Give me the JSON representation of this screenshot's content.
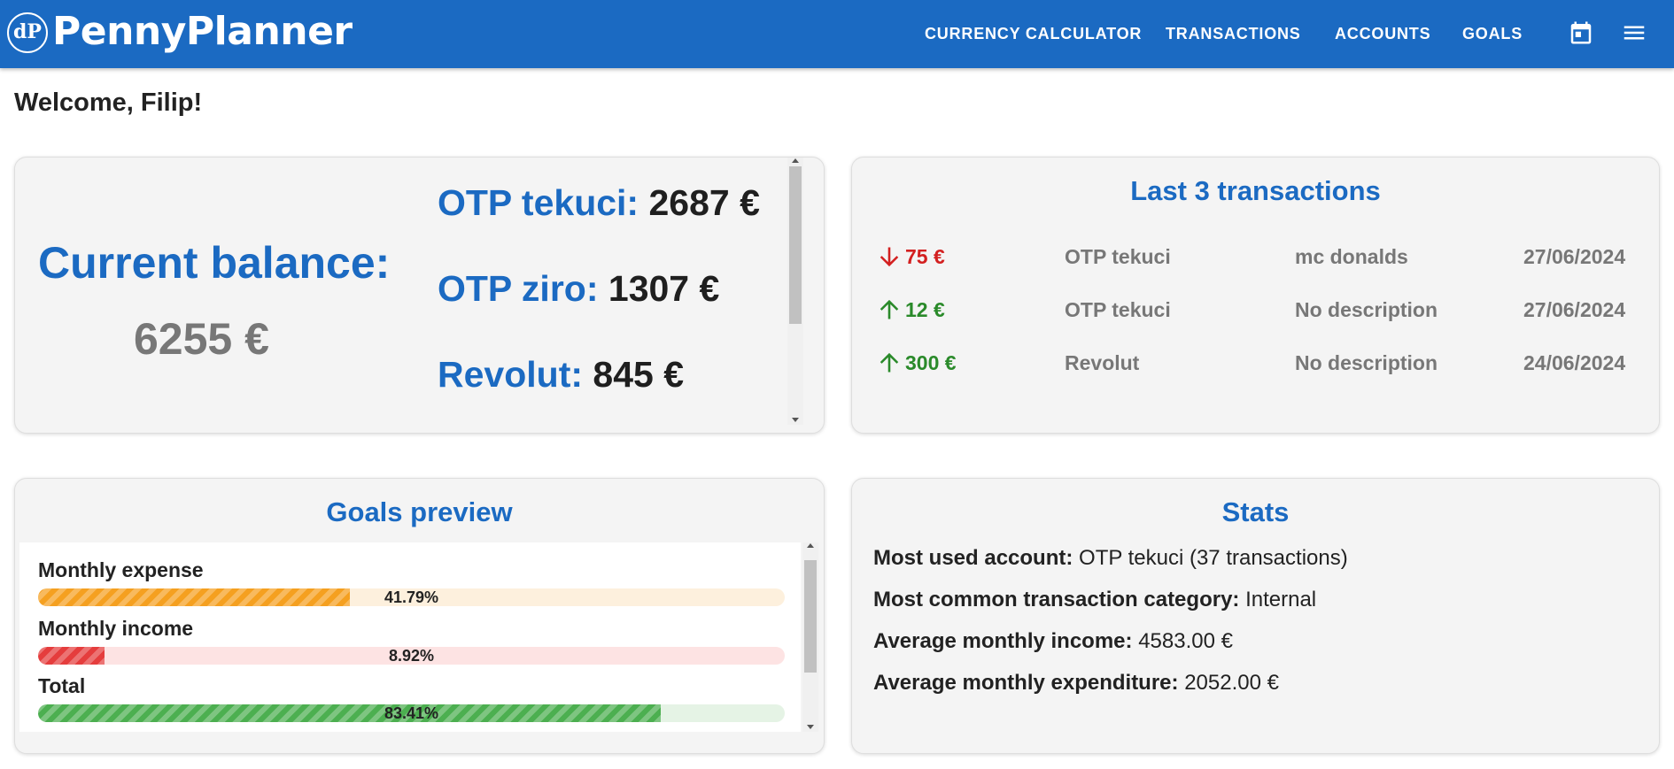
{
  "app": {
    "name": "PennyPlanner",
    "logo_text": "PENNY PLANNER"
  },
  "nav": {
    "items": [
      "CURRENCY CALCULATOR",
      "TRANSACTIONS",
      "ACCOUNTS",
      "GOALS"
    ],
    "icons": [
      "calendar-icon",
      "menu-icon"
    ]
  },
  "welcome": "Welcome, Filip!",
  "balance": {
    "label": "Current balance:",
    "value": "6255 €",
    "accounts": [
      {
        "name": "OTP tekuci:",
        "value": "2687 €"
      },
      {
        "name": "OTP ziro:",
        "value": "1307 €"
      },
      {
        "name": "Revolut:",
        "value": "845 €"
      }
    ]
  },
  "transactions": {
    "title": "Last 3 transactions",
    "rows": [
      {
        "direction": "down",
        "amount": "75 €",
        "account": "OTP tekuci",
        "description": "mc donalds",
        "date": "27/06/2024"
      },
      {
        "direction": "up",
        "amount": "12 €",
        "account": "OTP tekuci",
        "description": "No description",
        "date": "27/06/2024"
      },
      {
        "direction": "up",
        "amount": "300 €",
        "account": "Revolut",
        "description": "No description",
        "date": "24/06/2024"
      }
    ]
  },
  "goals": {
    "title": "Goals preview",
    "items": [
      {
        "label": "Monthly expense",
        "percent": 41.79,
        "percent_text": "41.79%",
        "color": "#f5a020",
        "track": "#fdf0dd"
      },
      {
        "label": "Monthly income",
        "percent": 8.92,
        "percent_text": "8.92%",
        "color": "#e53d3d",
        "track": "#fde3e3"
      },
      {
        "label": "Total",
        "percent": 83.41,
        "percent_text": "83.41%",
        "color": "#4caf50",
        "track": "#e5f3e5"
      }
    ]
  },
  "stats": {
    "title": "Stats",
    "items": [
      {
        "label": "Most used account:",
        "value": "OTP tekuci (37 transactions)"
      },
      {
        "label": "Most common transaction category:",
        "value": "Internal"
      },
      {
        "label": "Average monthly income:",
        "value": "4583.00 €"
      },
      {
        "label": "Average monthly expenditure:",
        "value": "2052.00 €"
      }
    ]
  },
  "colors": {
    "primary": "#1b6ac2",
    "negative": "#d32020",
    "positive": "#2a8a2a"
  }
}
